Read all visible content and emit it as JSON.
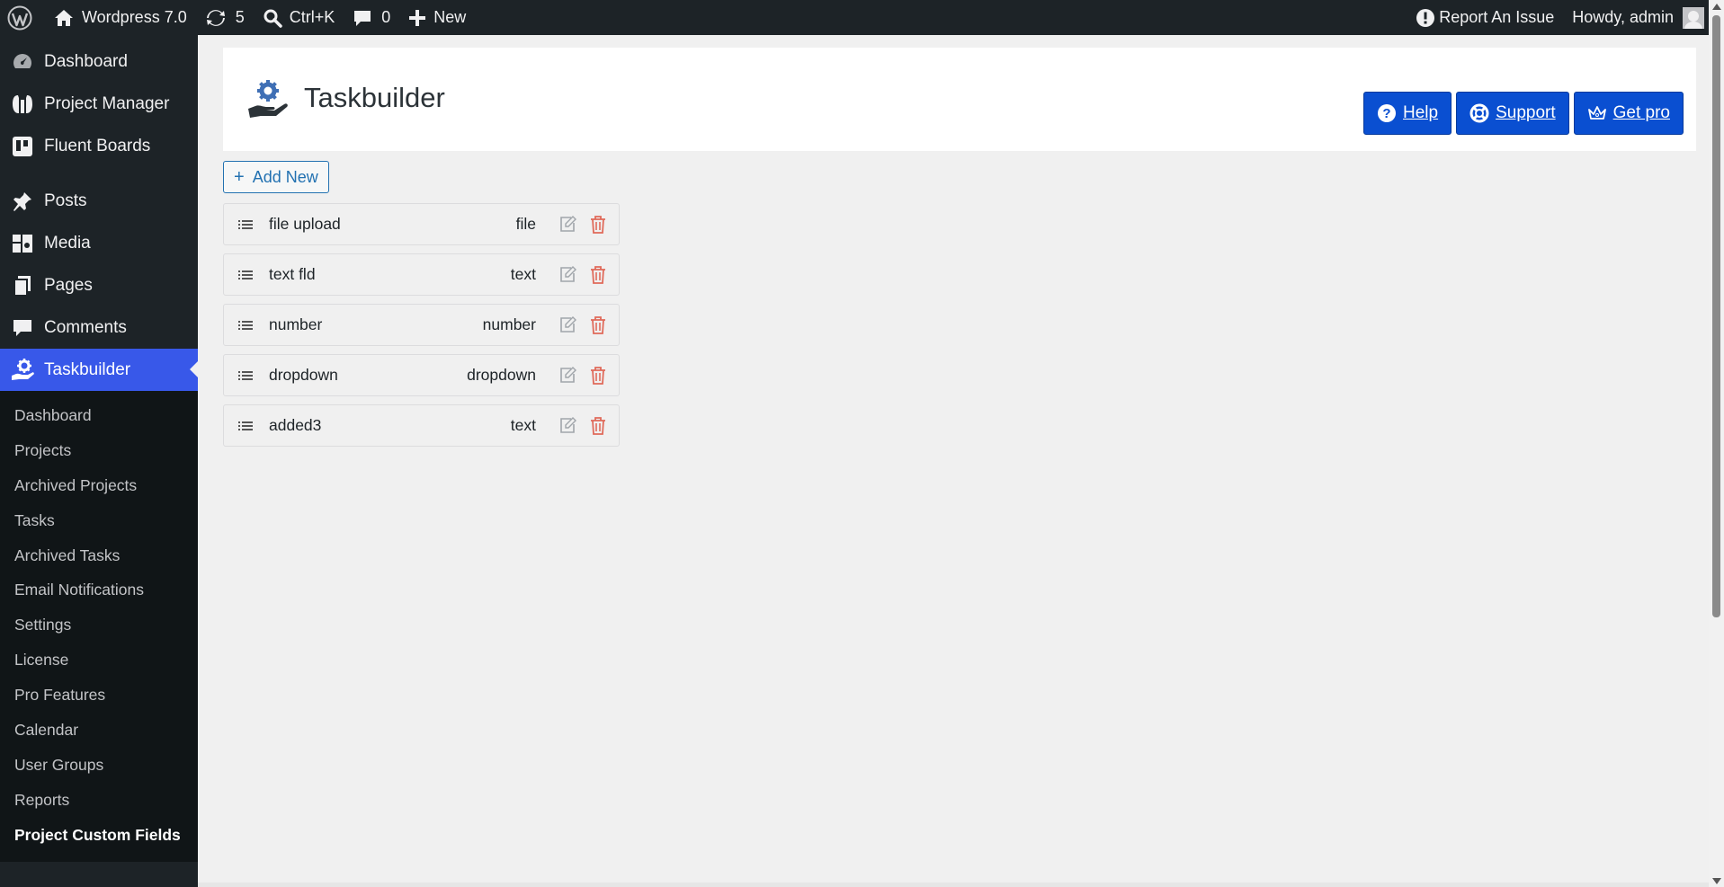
{
  "adminbar": {
    "site_name": "Wordpress 7.0",
    "updates_count": "5",
    "search_shortcut": "Ctrl+K",
    "comments_count": "0",
    "new_label": "New",
    "report_issue": "Report An Issue",
    "howdy": "Howdy, admin"
  },
  "sidebar": {
    "top_items": [
      {
        "label": "Dashboard",
        "icon": "dashboard-icon"
      },
      {
        "label": "Project Manager",
        "icon": "project-manager-icon"
      },
      {
        "label": "Fluent Boards",
        "icon": "fluent-boards-icon"
      }
    ],
    "items": [
      {
        "label": "Posts",
        "icon": "pin-icon"
      },
      {
        "label": "Media",
        "icon": "media-icon"
      },
      {
        "label": "Pages",
        "icon": "pages-icon"
      },
      {
        "label": "Comments",
        "icon": "comments-icon"
      },
      {
        "label": "Taskbuilder",
        "icon": "taskbuilder-icon"
      }
    ],
    "submenu": [
      "Dashboard",
      "Projects",
      "Archived Projects",
      "Tasks",
      "Archived Tasks",
      "Email Notifications",
      "Settings",
      "License",
      "Pro Features",
      "Calendar",
      "User Groups",
      "Reports",
      "Project Custom Fields"
    ]
  },
  "header": {
    "title": "Taskbuilder",
    "buttons": {
      "help": "Help",
      "support": "Support",
      "get_pro": "Get pro"
    }
  },
  "add_new_label": "Add New",
  "fields": [
    {
      "name": "file upload",
      "type": "file"
    },
    {
      "name": "text fld",
      "type": "text"
    },
    {
      "name": "number",
      "type": "number"
    },
    {
      "name": "dropdown",
      "type": "dropdown"
    },
    {
      "name": "added3",
      "type": "text"
    }
  ],
  "colors": {
    "adminbar_bg": "#1d2327",
    "active_menu": "#3858e9",
    "pro_button": "#0a4fd1",
    "delete_icon": "#e06a5a"
  }
}
